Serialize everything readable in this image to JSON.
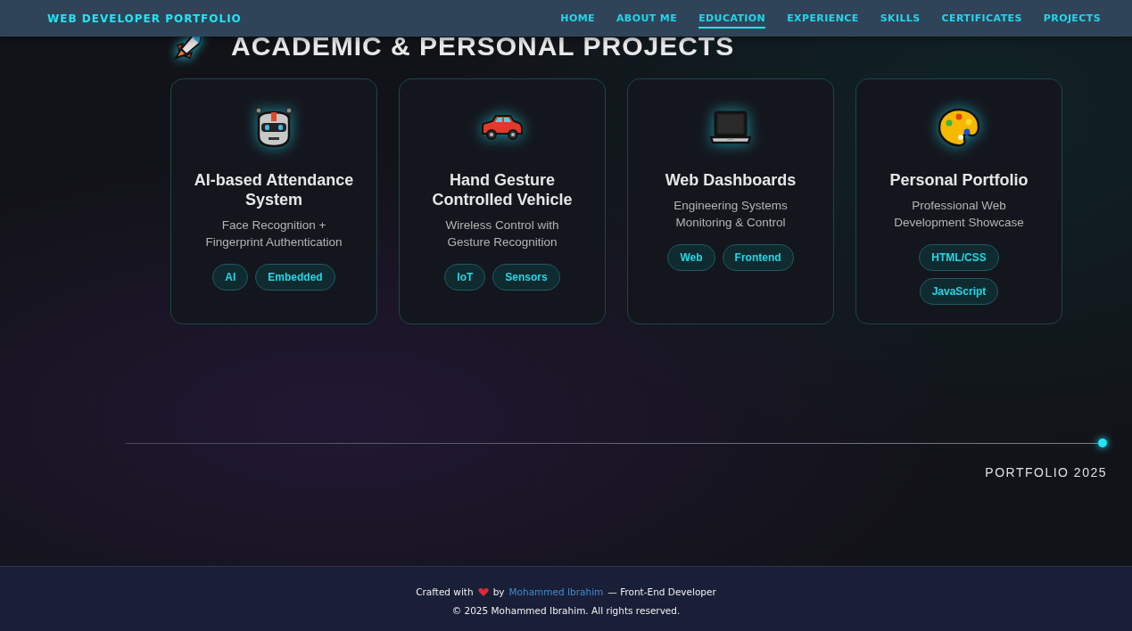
{
  "nav": {
    "brand": "WEB DEVELOPER PORTFOLIO",
    "links": [
      {
        "label": "HOME",
        "selected": false
      },
      {
        "label": "ABOUT ME",
        "selected": false
      },
      {
        "label": "EDUCATION",
        "selected": true
      },
      {
        "label": "EXPERIENCE",
        "selected": false
      },
      {
        "label": "SKILLS",
        "selected": false
      },
      {
        "label": "CERTIFICATES",
        "selected": false
      },
      {
        "label": "PROJECTS",
        "selected": false
      }
    ]
  },
  "section": {
    "title": "ACADEMIC & PERSONAL PROJECTS",
    "projects": [
      {
        "title": "AI-based Attendance System",
        "description": "Face Recognition + Fingerprint Authentication",
        "tags": [
          "AI",
          "Embedded"
        ]
      },
      {
        "title": "Hand Gesture Controlled Vehicle",
        "description": "Wireless Control with Gesture Recognition",
        "tags": [
          "IoT",
          "Sensors"
        ]
      },
      {
        "title": "Web Dashboards",
        "description": "Engineering Systems Monitoring & Control",
        "tags": [
          "Web",
          "Frontend"
        ]
      },
      {
        "title": "Personal Portfolio",
        "description": "Professional Web Development Showcase",
        "tags": [
          "HTML/CSS",
          "JavaScript"
        ]
      }
    ]
  },
  "timeline_label": "PORTFOLIO 2025",
  "footer": {
    "credit_prefix": "Crafted with",
    "credit_by": "by",
    "author": "Mohammed Ibrahim",
    "credit_suffix": "— Front-End Developer",
    "copyright": "© 2025 Mohammed Ibrahim. All rights reserved."
  }
}
